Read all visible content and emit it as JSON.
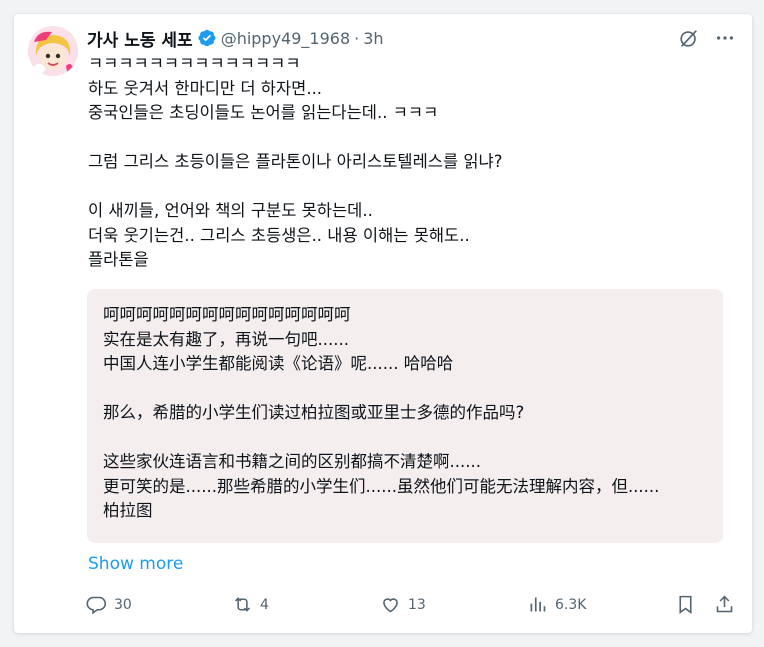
{
  "author": {
    "display_name": "가사 노동 세포",
    "handle": "@hippy49_1968",
    "separator": "·",
    "time": "3h"
  },
  "post": {
    "text": "ㅋㅋㅋㅋㅋㅋㅋㅋㅋㅋㅋㅋㅋㅋ\n하도 웃겨서 한마디만 더 하자면...\n중국인들은 초딩이들도 논어를 읽는다는데.. ㅋㅋㅋ\n\n그럼 그리스 초등이들은 플라톤이나 아리스토텔레스를 읽냐?\n\n이 새끼들, 언어와 책의 구분도 못하는데..\n더욱 웃기는건.. 그리스 초등생은.. 내용 이해는 못해도..\n플라톤을"
  },
  "translation": {
    "text": "呵呵呵呵呵呵呵呵呵呵呵呵呵呵呵\n实在是太有趣了，再说一句吧......\n中国人连小学生都能阅读《论语》呢...... 哈哈哈\n\n那么，希腊的小学生们读过柏拉图或亚里士多德的作品吗?\n\n这些家伙连语言和书籍之间的区别都搞不清楚啊......\n更可笑的是......那些希腊的小学生们......虽然他们可能无法理解内容，但......\n柏拉图"
  },
  "show_more_label": "Show more",
  "actions": {
    "replies": "30",
    "reposts": "4",
    "likes": "13",
    "views": "6.3K"
  },
  "colors": {
    "accent": "#1d9bf0",
    "muted": "#536471",
    "translation_bg": "#f4eeef"
  },
  "icons": [
    "grok-icon",
    "more-icon",
    "reply-icon",
    "repost-icon",
    "like-icon",
    "views-icon",
    "bookmark-icon",
    "share-icon"
  ]
}
